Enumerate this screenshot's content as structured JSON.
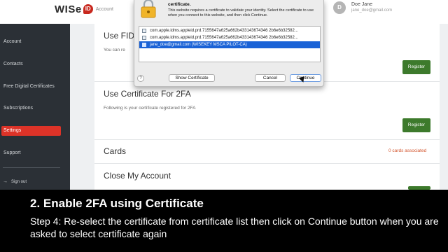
{
  "header": {
    "logo_text": "WISe",
    "logo_mark": "ID",
    "logo_subtitle": "Account",
    "user_initials": "D",
    "user_name": "Doe Jane",
    "user_email": "jane_doe@gmail.com"
  },
  "sidebar": {
    "items": [
      {
        "label": "Account",
        "active": false
      },
      {
        "label": "Contacts",
        "active": false
      },
      {
        "label": "Free Digital Certificates",
        "active": false
      },
      {
        "label": "Subscriptions",
        "active": false
      },
      {
        "label": "Settings",
        "active": true
      },
      {
        "label": "Support",
        "active": false
      }
    ],
    "signout_label": "Sign out"
  },
  "main": {
    "section1": {
      "title": "Use FID",
      "subtitle": "You can re",
      "button": "Register"
    },
    "section2": {
      "title": "Use Certificate For 2FA",
      "subtitle": "Following is your certificate registered for 2FA",
      "button": "Register"
    },
    "section3": {
      "title": "Cards",
      "link": "0 cards associated"
    },
    "section4": {
      "title": "Close My Account"
    }
  },
  "dialog": {
    "title": "certificate.",
    "message": "This website requires a certificate to validate your identity. Select the certificate to use when you connect to this website, and then click Continue.",
    "certificates": [
      {
        "label": "com.apple.idms.appleid.prd.7155647a625a662b433143674346 2b6e6b32582...",
        "selected": false
      },
      {
        "label": "com.apple.idms.appleid.prd.7155647a625a662b433143674346 2b6e6b32582...",
        "selected": false
      },
      {
        "label": "jane_doe@gmail.com  (WISEKEY MSCA PILOT-CA)",
        "selected": true
      }
    ],
    "help_label": "?",
    "show_certificate": "Show Certificate",
    "cancel": "Cancel",
    "continue": "Continue"
  },
  "caption": {
    "title": "2. Enable 2FA using Certificate",
    "text": "Step 4: Re-select the certificate from certificate list then click on Continue button when you are asked to select certificate again"
  }
}
